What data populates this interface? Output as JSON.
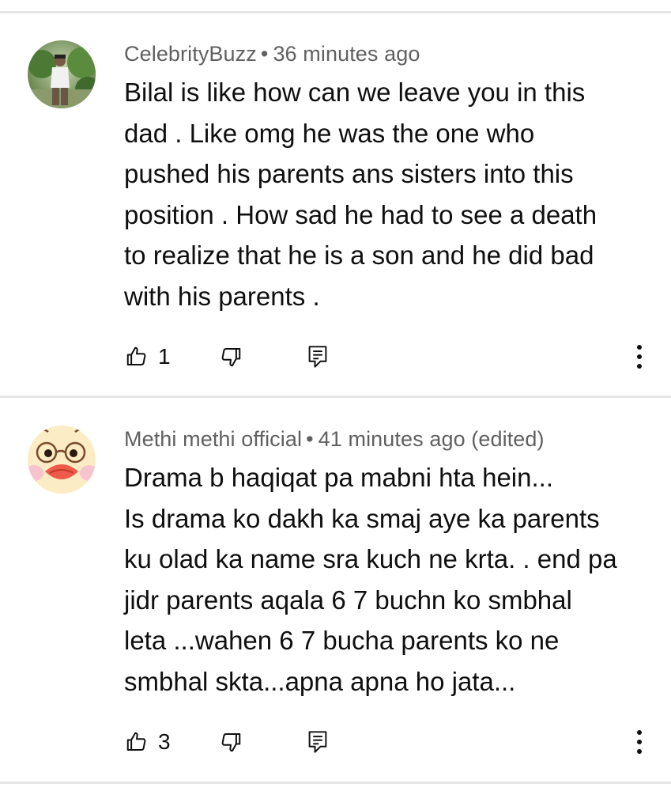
{
  "comments": [
    {
      "author": "CelebrityBuzz",
      "separator": "•",
      "time": "36 minutes ago",
      "text": "Bilal is like how can we leave you in this\ndad . Like omg he was the one who\npushed his parents ans sisters into this\nposition . How sad he had to see a death\nto realize that he is a son and he did bad\nwith his parents .",
      "likes": "1",
      "avatar_icon": "user-photo-avatar",
      "actions": [
        "like-icon",
        "dislike-icon",
        "reply-icon",
        "more-vert-icon"
      ]
    },
    {
      "author": "Methi methi official",
      "separator": "•",
      "time": "41 minutes ago (edited)",
      "text": "Drama b haqiqat pa mabni hta hein...\nIs drama ko dakh ka smaj aye ka parents\nku olad ka name sra kuch ne krta. . end pa\njidr parents aqala 6 7 buchn ko smbhal\nleta ...wahen 6 7 bucha parents ko ne\nsmbhal skta...apna apna ho jata...",
      "likes": "3",
      "avatar_icon": "cartoon-duck-avatar",
      "actions": [
        "like-icon",
        "dislike-icon",
        "reply-icon",
        "more-vert-icon"
      ]
    }
  ],
  "colors": {
    "meta_text": "#606060",
    "body_text": "#0f0f0f",
    "divider": "#e6e6e6"
  }
}
